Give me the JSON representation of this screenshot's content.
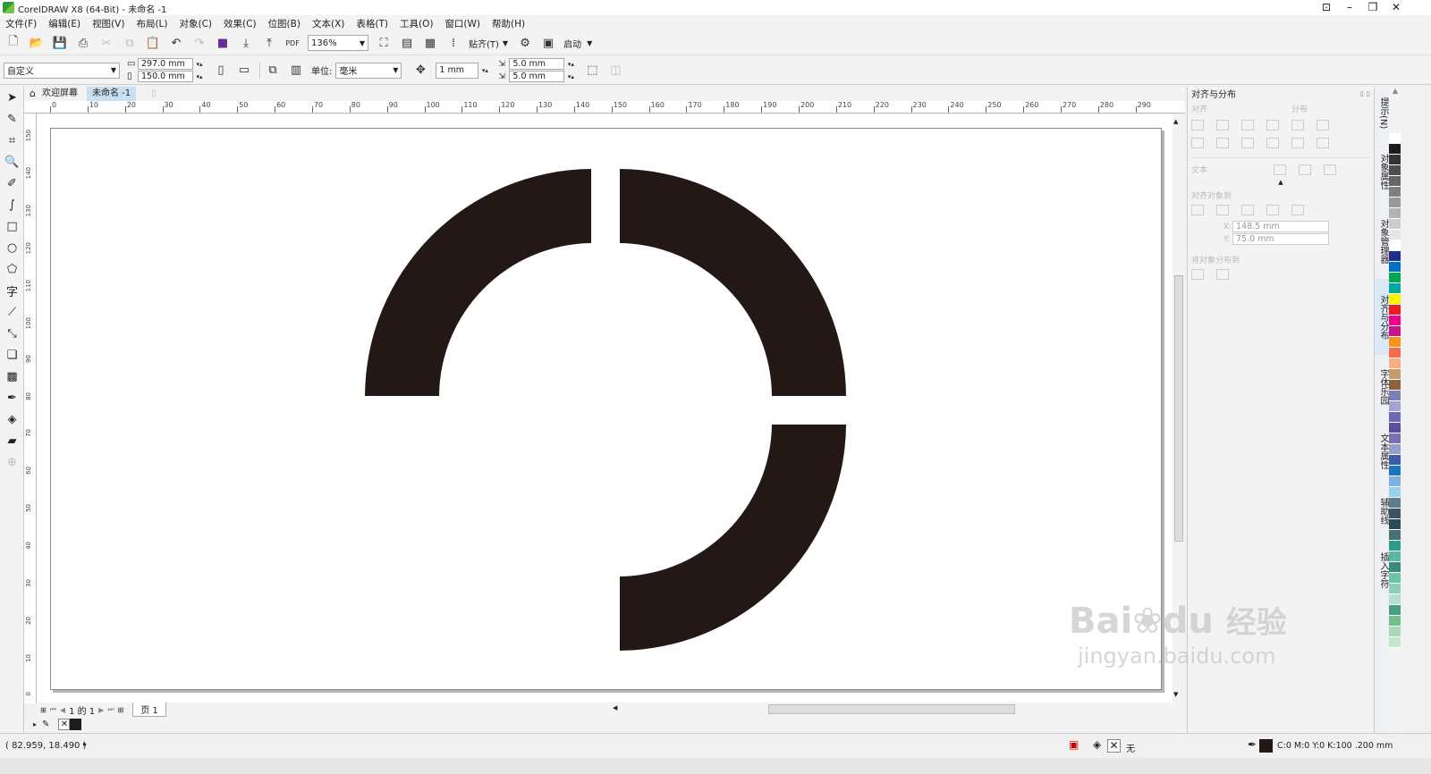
{
  "window": {
    "title": "CorelDRAW X8 (64-Bit) - 未命名 -1"
  },
  "menu": [
    "文件(F)",
    "编辑(E)",
    "视图(V)",
    "布局(L)",
    "对象(C)",
    "效果(C)",
    "位图(B)",
    "文本(X)",
    "表格(T)",
    "工具(O)",
    "窗口(W)",
    "帮助(H)"
  ],
  "toolbar1": {
    "zoom": "136%",
    "snap_label": "贴齐(T)",
    "launch_label": "启动"
  },
  "toolbar2": {
    "preset": "自定义",
    "width": "297.0 mm",
    "height": "150.0 mm",
    "unit_label": "单位:",
    "unit": "毫米",
    "nudge": "1 mm",
    "dup_x": "5.0 mm",
    "dup_y": "5.0 mm"
  },
  "tabs": {
    "welcome": "欢迎屏幕",
    "doc": "未命名 -1"
  },
  "ruler": {
    "h_labels": [
      "0",
      "10",
      "20",
      "30",
      "40",
      "50",
      "60",
      "70",
      "80",
      "90",
      "100",
      "110",
      "120",
      "130",
      "140",
      "150",
      "160",
      "170",
      "180",
      "190",
      "200",
      "210",
      "220",
      "230",
      "240",
      "250",
      "260",
      "270",
      "280",
      "290"
    ],
    "v_labels": [
      "150",
      "140",
      "130",
      "120",
      "110",
      "100",
      "90",
      "80",
      "70",
      "60",
      "50",
      "40",
      "30",
      "20",
      "10",
      "0"
    ]
  },
  "pagenav": {
    "position": "1 的 1",
    "page_tab": "页 1"
  },
  "status": {
    "coords": "( 82.959, 18.490 )",
    "fill_label": "无",
    "outline": "C:0 M:0 Y:0 K:100  .200 mm"
  },
  "docker": {
    "title": "对齐与分布",
    "align_label": "对齐",
    "distribute_label": "分布",
    "text_label": "文本",
    "align_to_label": "对齐对象到",
    "x_value": "148.5 mm",
    "y_value": "75.0 mm",
    "dist_to_label": "将对象分布到"
  },
  "side_tabs": [
    "提示(N)",
    "对象属性",
    "对象管理器",
    "对齐与分布",
    "字体乐园",
    "文本属性",
    "辅助线",
    "插入字符"
  ],
  "palette": [
    "#ffffff",
    "#1c1c1c",
    "#333333",
    "#4d4d4d",
    "#666666",
    "#808080",
    "#999999",
    "#b3b3b3",
    "#cccccc",
    "#e6e6e6",
    "#ffffff",
    "#1f2e8f",
    "#0070c0",
    "#00a651",
    "#00a99d",
    "#fff200",
    "#ed1c24",
    "#ec008c",
    "#c7148c",
    "#f7941d",
    "#f26c4f",
    "#f9ad81",
    "#c69c6d",
    "#8c6239",
    "#7b7fb6",
    "#a3a3d6",
    "#6e6ab0",
    "#5a4f9f",
    "#7c6fb3",
    "#94a0c8",
    "#3d5ca8",
    "#1b75bc",
    "#7fb1de",
    "#9ad0ec",
    "#5b7f8f",
    "#3b5366",
    "#2c4a52",
    "#4a7073",
    "#2a9d8f",
    "#5ab8a2",
    "#3a8a7d",
    "#6cc4a4",
    "#89d0b5",
    "#b3dfd0",
    "#4a9d7f",
    "#6fbf8f",
    "#a7d8b8",
    "#c4e6cf"
  ],
  "colors": {
    "shape_fill": "#231815",
    "page_border": "#8a8a8a",
    "accent": "#c8e0f4"
  },
  "watermark": {
    "brand": "Bai",
    "brand2": "du",
    "cn": "经验",
    "url": "jingyan.baidu.com"
  }
}
